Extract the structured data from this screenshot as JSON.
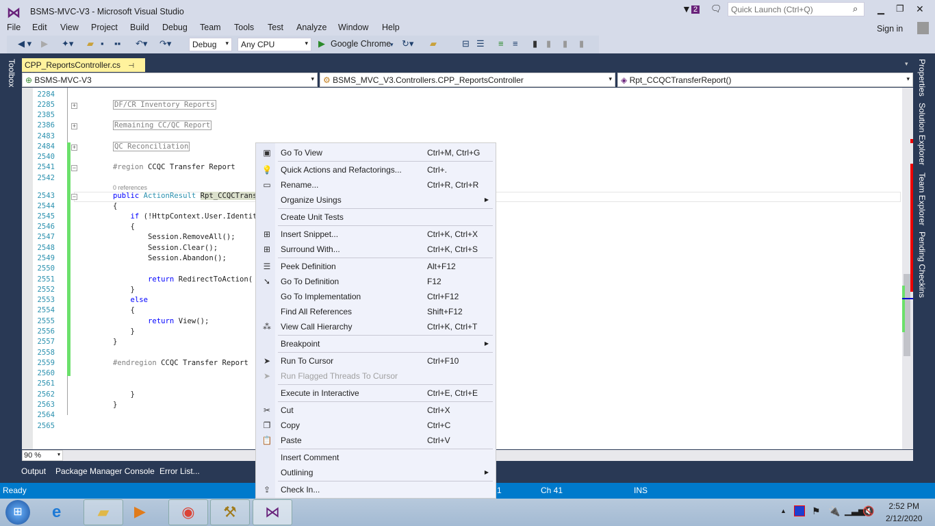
{
  "window": {
    "title": "BSMS-MVC-V3 - Microsoft Visual Studio",
    "notif_count": "2",
    "quick_launch_placeholder": "Quick Launch (Ctrl+Q)",
    "sign_in": "Sign in"
  },
  "menu": [
    "File",
    "Edit",
    "View",
    "Project",
    "Build",
    "Debug",
    "Team",
    "Tools",
    "Test",
    "Analyze",
    "Window",
    "Help"
  ],
  "toolbar": {
    "config": "Debug",
    "platform": "Any CPU",
    "run_target": "Google Chrome"
  },
  "editor_tab": {
    "label": "CPP_ReportsController.cs"
  },
  "navbar": {
    "project": "BSMS-MVC-V3",
    "class": "BSMS_MVC_V3.Controllers.CPP_ReportsController",
    "member": "Rpt_CCQCTransferReport()"
  },
  "code": {
    "lines": [
      {
        "n": "2284",
        "t": ""
      },
      {
        "n": "2285",
        "t": "DF/CR Inventory Reports",
        "box": true,
        "fold": "+"
      },
      {
        "n": "2385",
        "t": ""
      },
      {
        "n": "2386",
        "t": "Remaining CC/QC Report",
        "box": true,
        "fold": "+"
      },
      {
        "n": "2483",
        "t": ""
      },
      {
        "n": "2484",
        "t": "QC Reconciliation",
        "box": true,
        "fold": "+"
      },
      {
        "n": "2540",
        "t": ""
      },
      {
        "n": "2541",
        "t": "#region CCQC Transfer Report",
        "fold": "-"
      },
      {
        "n": "2542",
        "t": ""
      },
      {
        "n": "2543",
        "t": "public ActionResult Rpt_CCQCTrans",
        "fold": "-"
      },
      {
        "n": "2544",
        "t": "{"
      },
      {
        "n": "2545",
        "t": "    if (!HttpContext.User.Identit"
      },
      {
        "n": "2546",
        "t": "    {"
      },
      {
        "n": "2547",
        "t": "        Session.RemoveAll();"
      },
      {
        "n": "2548",
        "t": "        Session.Clear();"
      },
      {
        "n": "2549",
        "t": "        Session.Abandon();"
      },
      {
        "n": "2550",
        "t": ""
      },
      {
        "n": "2551",
        "t": "        return RedirectToAction("
      },
      {
        "n": "2552",
        "t": "    }"
      },
      {
        "n": "2553",
        "t": "    else"
      },
      {
        "n": "2554",
        "t": "    {"
      },
      {
        "n": "2555",
        "t": "        return View();"
      },
      {
        "n": "2556",
        "t": "    }"
      },
      {
        "n": "2557",
        "t": "}"
      },
      {
        "n": "2558",
        "t": ""
      },
      {
        "n": "2559",
        "t": "#endregion CCQC Transfer Report"
      },
      {
        "n": "2560",
        "t": ""
      },
      {
        "n": "2561",
        "t": ""
      },
      {
        "n": "2562",
        "t": "    }"
      },
      {
        "n": "2563",
        "t": "}"
      },
      {
        "n": "2564",
        "t": ""
      },
      {
        "n": "2565",
        "t": ""
      }
    ],
    "codelens": "0 references"
  },
  "zoom": "90 %",
  "bottom_tabs": [
    "Output",
    "Package Manager Console",
    "Error List..."
  ],
  "right_tabs": [
    "Properties",
    "Solution Explorer",
    "Team Explorer",
    "Pending Checkins"
  ],
  "left_tabs": [
    "Toolbox"
  ],
  "status": {
    "text": "Ready",
    "ln": "1",
    "ch": "Ch 41",
    "mode": "INS"
  },
  "context_menu": [
    {
      "label": "Go To View",
      "shortcut": "Ctrl+M, Ctrl+G",
      "icon": "go-to-view-icon",
      "glyph": "▣"
    },
    {
      "sep": true
    },
    {
      "label": "Quick Actions and Refactorings...",
      "shortcut": "Ctrl+.",
      "icon": "lightbulb-icon",
      "glyph": "💡"
    },
    {
      "label": "Rename...",
      "shortcut": "Ctrl+R, Ctrl+R",
      "icon": "rename-icon",
      "glyph": "▭"
    },
    {
      "label": "Organize Usings",
      "submenu": true
    },
    {
      "sep": true
    },
    {
      "label": "Create Unit Tests"
    },
    {
      "sep": true
    },
    {
      "label": "Insert Snippet...",
      "shortcut": "Ctrl+K, Ctrl+X",
      "icon": "insert-snippet-icon",
      "glyph": "⊞"
    },
    {
      "label": "Surround With...",
      "shortcut": "Ctrl+K, Ctrl+S",
      "icon": "surround-with-icon",
      "glyph": "⊞"
    },
    {
      "sep": true
    },
    {
      "label": "Peek Definition",
      "shortcut": "Alt+F12",
      "icon": "peek-definition-icon",
      "glyph": "☰"
    },
    {
      "label": "Go To Definition",
      "shortcut": "F12",
      "icon": "go-to-definition-icon",
      "glyph": "➘"
    },
    {
      "label": "Go To Implementation",
      "shortcut": "Ctrl+F12"
    },
    {
      "label": "Find All References",
      "shortcut": "Shift+F12"
    },
    {
      "label": "View Call Hierarchy",
      "shortcut": "Ctrl+K, Ctrl+T",
      "icon": "call-hierarchy-icon",
      "glyph": "⁂"
    },
    {
      "sep": true
    },
    {
      "label": "Breakpoint",
      "submenu": true
    },
    {
      "sep": true
    },
    {
      "label": "Run To Cursor",
      "shortcut": "Ctrl+F10",
      "icon": "cursor-icon",
      "glyph": "➤"
    },
    {
      "label": "Run Flagged Threads To Cursor",
      "disabled": true,
      "icon": "cursor-disabled-icon",
      "glyph": "➤"
    },
    {
      "sep": true
    },
    {
      "label": "Execute in Interactive",
      "shortcut": "Ctrl+E, Ctrl+E"
    },
    {
      "sep": true
    },
    {
      "label": "Cut",
      "shortcut": "Ctrl+X",
      "icon": "cut-icon",
      "glyph": "✂"
    },
    {
      "label": "Copy",
      "shortcut": "Ctrl+C",
      "icon": "copy-icon",
      "glyph": "❐"
    },
    {
      "label": "Paste",
      "shortcut": "Ctrl+V",
      "icon": "paste-icon",
      "glyph": "📋"
    },
    {
      "sep": true
    },
    {
      "label": "Insert Comment"
    },
    {
      "label": "Outlining",
      "submenu": true
    },
    {
      "sep": true
    },
    {
      "label": "Check In...",
      "icon": "check-in-icon",
      "glyph": "⇪"
    }
  ],
  "clock": {
    "time": "2:52 PM",
    "date": "2/12/2020"
  },
  "colors": {
    "accent": "#007acc",
    "vs_purple": "#68217a",
    "tab_active": "#fff29d",
    "chrome_dark": "#293955"
  }
}
